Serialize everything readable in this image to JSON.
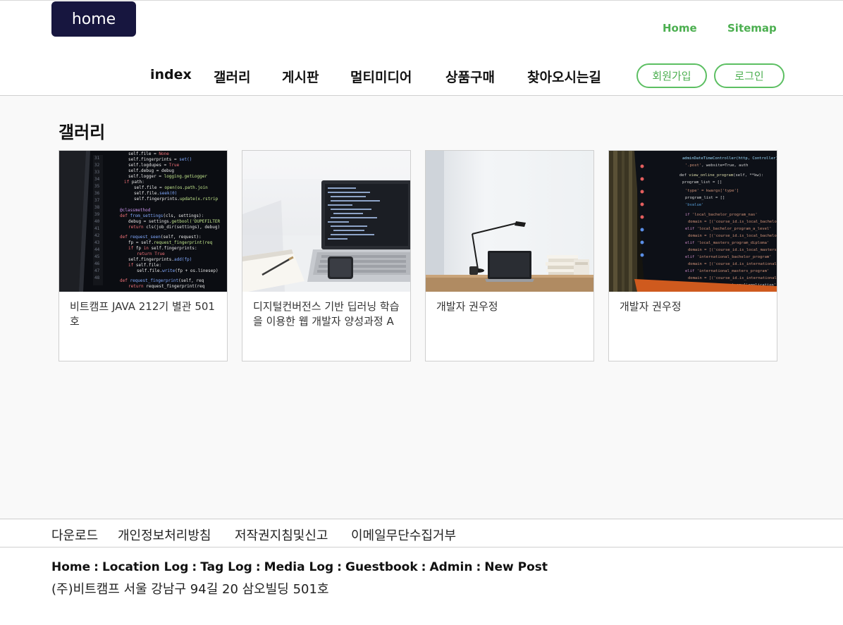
{
  "header": {
    "logo": "home",
    "util_links": [
      "Home",
      "Sitemap"
    ],
    "nav": [
      "index",
      "갤러리",
      "게시판",
      "멀티미디어",
      "상품구매",
      "찾아오시는길"
    ],
    "join_button": "회원가입",
    "login_button": "로그인"
  },
  "gallery": {
    "title": "갤러리",
    "cards": [
      {
        "caption": "비트캠프 JAVA 212기 별관 501호",
        "image": "code-screen-photo"
      },
      {
        "caption": "디지털컨버전스 기반 딥러닝 학습을 이용한 웹 개발자 양성과정 A",
        "image": "laptop-desk-photo"
      },
      {
        "caption": "개발자 권우정",
        "image": "workspace-lamp-photo"
      },
      {
        "caption": "개발자 권우정",
        "image": "monitor-code-photo"
      }
    ]
  },
  "footer": {
    "links": [
      "다운로드",
      "개인정보처리방침",
      "저작권지침및신고",
      "이메일무단수집거부"
    ],
    "nav_links": [
      "Home",
      "Location Log",
      "Tag Log",
      "Media Log",
      "Guestbook",
      "Admin",
      "New Post"
    ],
    "separator": ":",
    "address": "(주)비트캠프 서울 강남구 94길 20 삼오빌딩 501호"
  },
  "colors": {
    "accent": "#4caf50",
    "logo_bg": "#17163f",
    "main_bg": "#f9f9f9"
  }
}
